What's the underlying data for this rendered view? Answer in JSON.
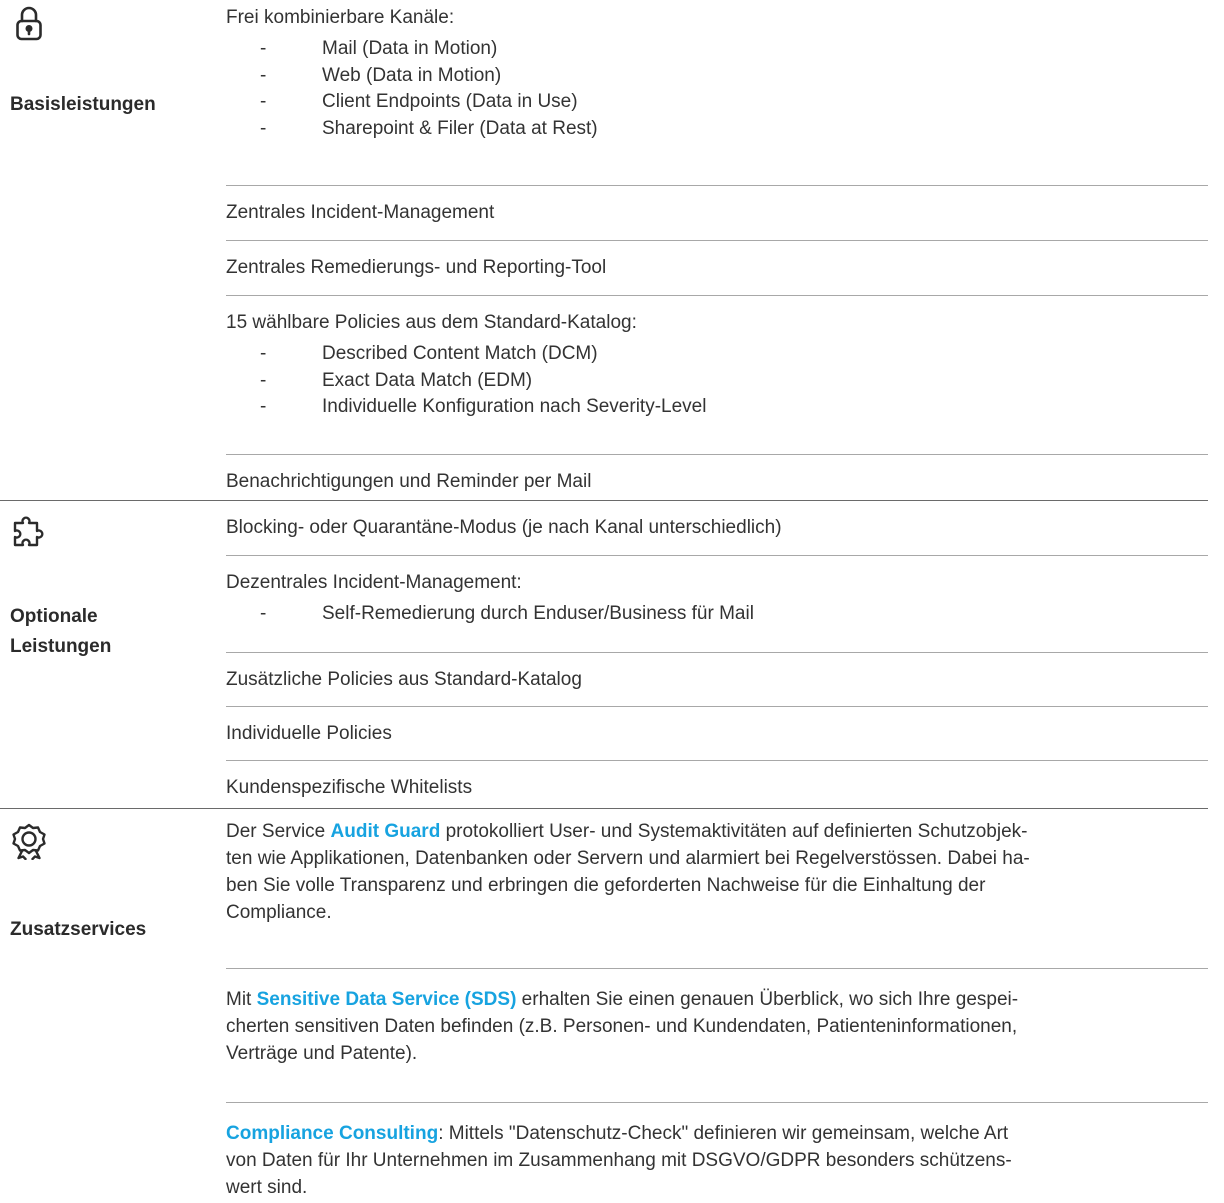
{
  "colors": {
    "accent": "#17a3e0",
    "text": "#333333",
    "divider": "#a8a8a8"
  },
  "sections": {
    "basis": {
      "icon": "padlock-icon",
      "title": "Basisleistungen",
      "channels_intro": "Frei kombinierbare Kanäle:",
      "channels": [
        "Mail (Data in Motion)",
        "Web (Data in Motion)",
        "Client Endpoints (Data in Use)",
        "Sharepoint & Filer (Data at Rest)"
      ],
      "incident": "Zentrales Incident-Management",
      "remediation": "Zentrales Remedierungs- und Reporting-Tool",
      "policies_intro": "15 wählbare Policies aus dem Standard-Katalog:",
      "policies": [
        "Described Content Match (DCM)",
        "Exact Data Match (EDM)",
        "Individuelle Konfiguration nach Severity-Level"
      ],
      "notifications": "Benachrichtigungen und Reminder per Mail"
    },
    "optional": {
      "icon": "puzzle-piece-icon",
      "title_line1": "Optionale",
      "title_line2": "Leistungen",
      "blocking": "Blocking- oder Quarantäne-Modus (je nach Kanal unterschiedlich)",
      "decentral_intro": "Dezentrales Incident-Management:",
      "decentral_items": [
        "Self-Remedierung durch Enduser/Business für Mail"
      ],
      "extra_policies": "Zusätzliche Policies aus Standard-Katalog",
      "individual_policies": "Individuelle Policies",
      "whitelists": "Kundenspezifische Whitelists"
    },
    "extra": {
      "icon": "award-badge-icon",
      "title": "Zusatzservices",
      "audit": {
        "pre": "Der Service ",
        "name": "Audit Guard",
        "line1_post": " protokolliert User- und Systemaktivitäten auf definierten Schutzobjek-",
        "line2": "ten wie Applikationen, Datenbanken oder Servern und alarmiert bei Regelverstössen. Dabei ha-",
        "line3": "ben Sie volle Transparenz und erbringen die geforderten Nachweise für die Einhaltung der",
        "line4": "Compliance."
      },
      "sds": {
        "pre": "Mit ",
        "name": "Sensitive Data Service (SDS)",
        "line1_post": " erhalten Sie einen genauen Überblick, wo sich Ihre gespei-",
        "line2": "cherten sensitiven Daten befinden (z.B. Personen- und Kundendaten, Patienteninformationen,",
        "line3": "Verträge und Patente)."
      },
      "consulting": {
        "name": "Compliance Consulting",
        "line1_post": ": Mittels \"Datenschutz-Check\" definieren wir gemeinsam, welche Art",
        "line2": "von Daten für Ihr Unternehmen im Zusammenhang mit DSGVO/GDPR besonders schützens-",
        "line3": "wert sind."
      }
    }
  }
}
